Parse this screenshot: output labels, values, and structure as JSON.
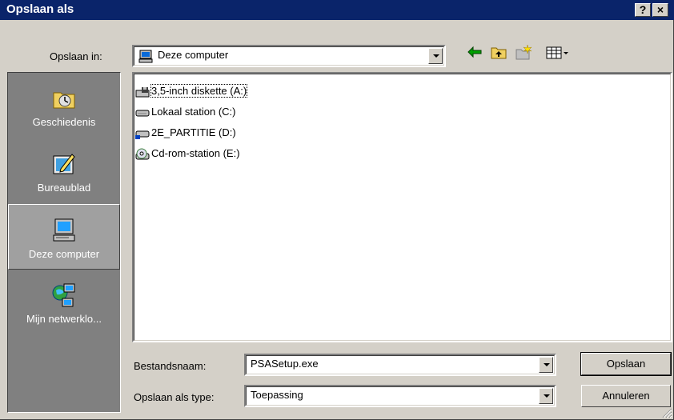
{
  "window": {
    "title": "Opslaan als",
    "help_label": "?",
    "close_label": "×"
  },
  "save_in": {
    "label": "Opslaan in:",
    "value": "Deze computer",
    "icon": "computer-icon"
  },
  "toolbar": {
    "back_icon": "back-arrow-icon",
    "up_icon": "up-folder-icon",
    "new_folder_icon": "new-folder-icon",
    "view_icon": "view-menu-icon"
  },
  "places": [
    {
      "label": "Geschiedenis",
      "icon": "history-icon"
    },
    {
      "label": "Bureaublad",
      "icon": "desktop-icon"
    },
    {
      "label": "Deze computer",
      "icon": "computer-icon"
    },
    {
      "label": "Mijn netwerklo...",
      "icon": "network-icon"
    }
  ],
  "files": [
    {
      "label": "3,5-inch diskette (A:)",
      "icon": "floppy-drive-icon"
    },
    {
      "label": "Lokaal station (C:)",
      "icon": "hard-drive-icon"
    },
    {
      "label": "2E_PARTITIE (D:)",
      "icon": "hard-drive-icon"
    },
    {
      "label": "Cd-rom-station (E:)",
      "icon": "cd-drive-icon"
    }
  ],
  "filename": {
    "label": "Bestandsnaam:",
    "value": "PSASetup.exe"
  },
  "filetype": {
    "label": "Opslaan als type:",
    "value": "Toepassing"
  },
  "buttons": {
    "save": "Opslaan",
    "cancel": "Annuleren"
  },
  "colors": {
    "titlebar": "#0a246a",
    "face": "#d4d0c8",
    "places_bg": "#808080"
  }
}
